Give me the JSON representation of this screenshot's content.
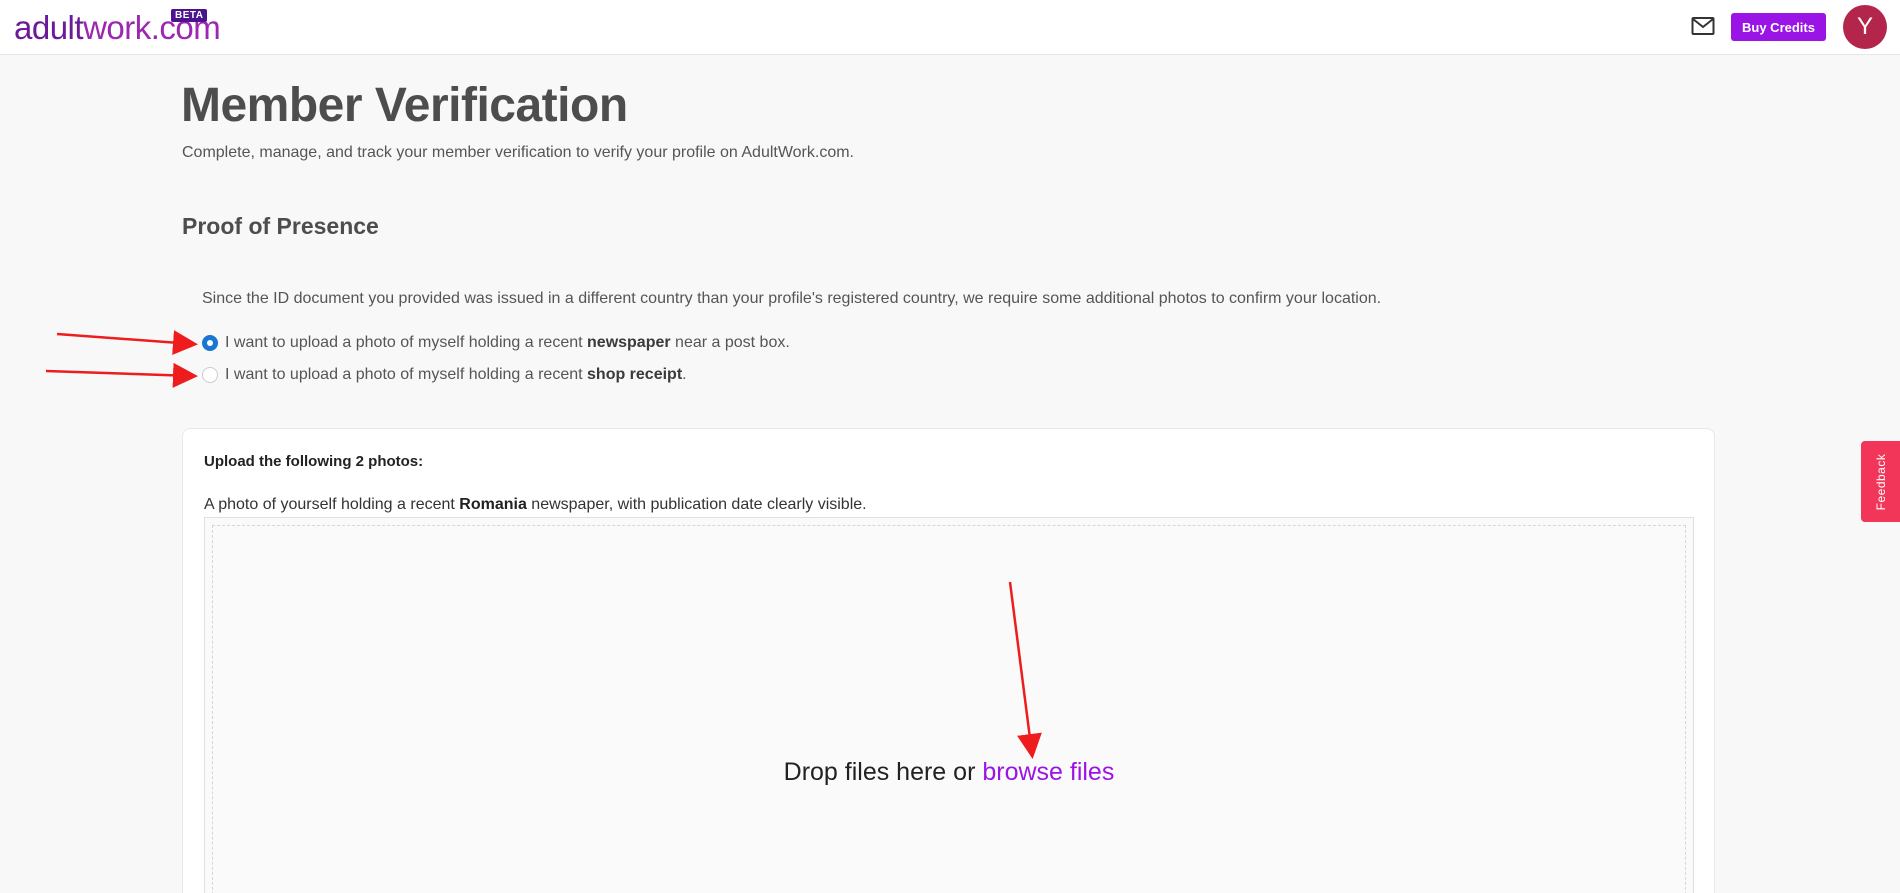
{
  "header": {
    "logo_part1": "adult",
    "logo_part2": "work.com",
    "beta_badge": "BETA",
    "mail_icon": "mail-icon",
    "buy_credits_label": "Buy Credits",
    "avatar_initial": "Y",
    "avatar_color": "#b3254a",
    "accent_color": "#9b14e6"
  },
  "main": {
    "title": "Member Verification",
    "subtitle": "Complete, manage, and track your member verification to verify your profile on AdultWork.com.",
    "section_title": "Proof of Presence",
    "notice": "Since the ID document you provided was issued in a different country than your profile's registered country, we require some additional photos to confirm your location.",
    "options": [
      {
        "prefix": "I want to upload a photo of myself holding a recent ",
        "bold": "newspaper",
        "suffix": " near a post box.",
        "checked": true
      },
      {
        "prefix": "I want to upload a photo of myself holding a recent ",
        "bold": "shop receipt",
        "suffix": ".",
        "checked": false
      }
    ]
  },
  "upload": {
    "heading": "Upload the following 2 photos:",
    "desc_prefix": "A photo of yourself holding a recent ",
    "desc_bold": "Romania",
    "desc_suffix": " newspaper, with publication date clearly visible.",
    "drop_text": "Drop files here or ",
    "browse_text": "browse files"
  },
  "feedback": {
    "label": "Feedback"
  }
}
